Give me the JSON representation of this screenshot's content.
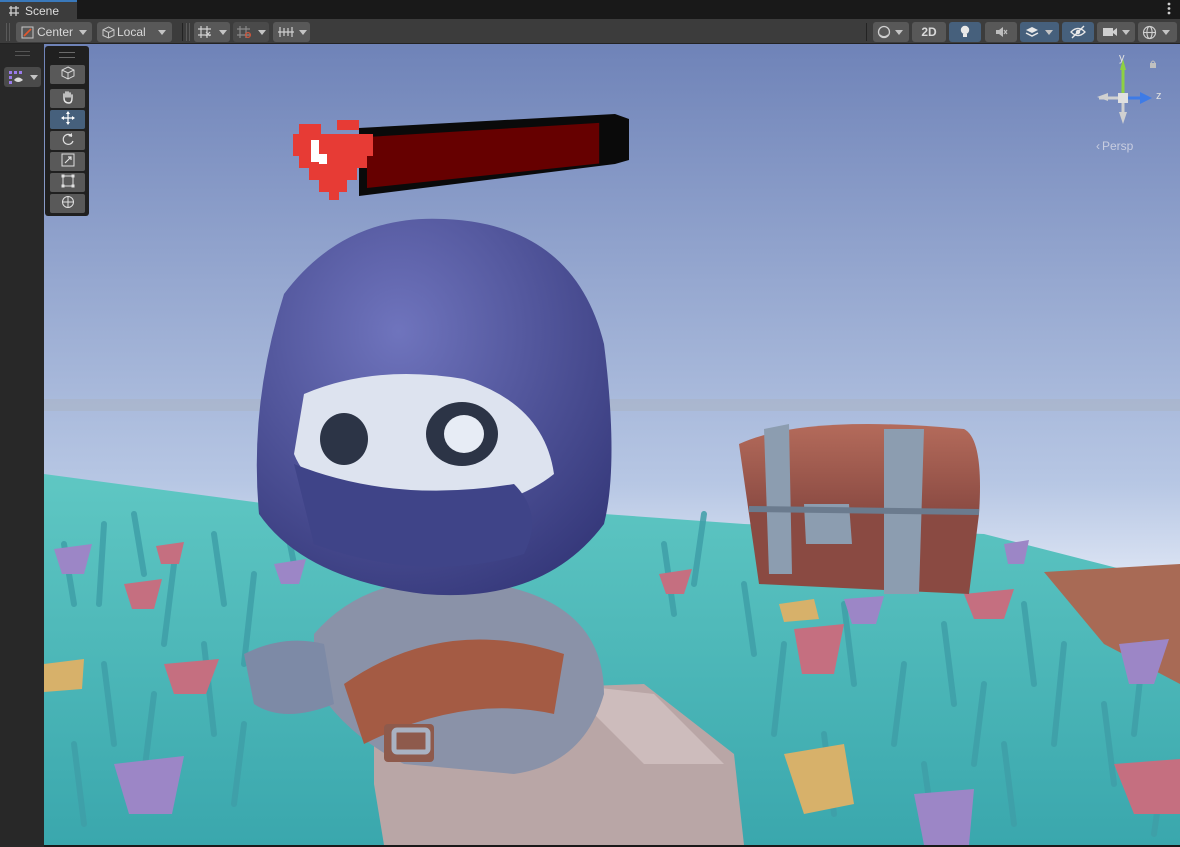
{
  "window": {
    "tab_title": "Scene"
  },
  "toolbar": {
    "pivot_label": "Center",
    "space_label": "Local",
    "mode_2d_label": "2D"
  },
  "viewport": {
    "camera_label": "Persp",
    "gizmo_axes": {
      "y": "y",
      "z": "z"
    },
    "health_bar_fill": 0.94
  },
  "tools": [
    {
      "name": "view-tool",
      "icon": "cube-icon"
    },
    {
      "name": "hand-tool",
      "icon": "hand-icon"
    },
    {
      "name": "move-tool",
      "icon": "move-icon",
      "active": true
    },
    {
      "name": "rotate-tool",
      "icon": "rotate-icon"
    },
    {
      "name": "scale-tool",
      "icon": "scale-icon"
    },
    {
      "name": "rect-tool",
      "icon": "rect-icon"
    },
    {
      "name": "transform-tool",
      "icon": "transform-icon"
    }
  ],
  "colors": {
    "active_accent": "#46607c",
    "gizmo_y": "#8ed143",
    "gizmo_z": "#3e7be6",
    "heart": "#e73b35",
    "health_fill": "#660000"
  }
}
